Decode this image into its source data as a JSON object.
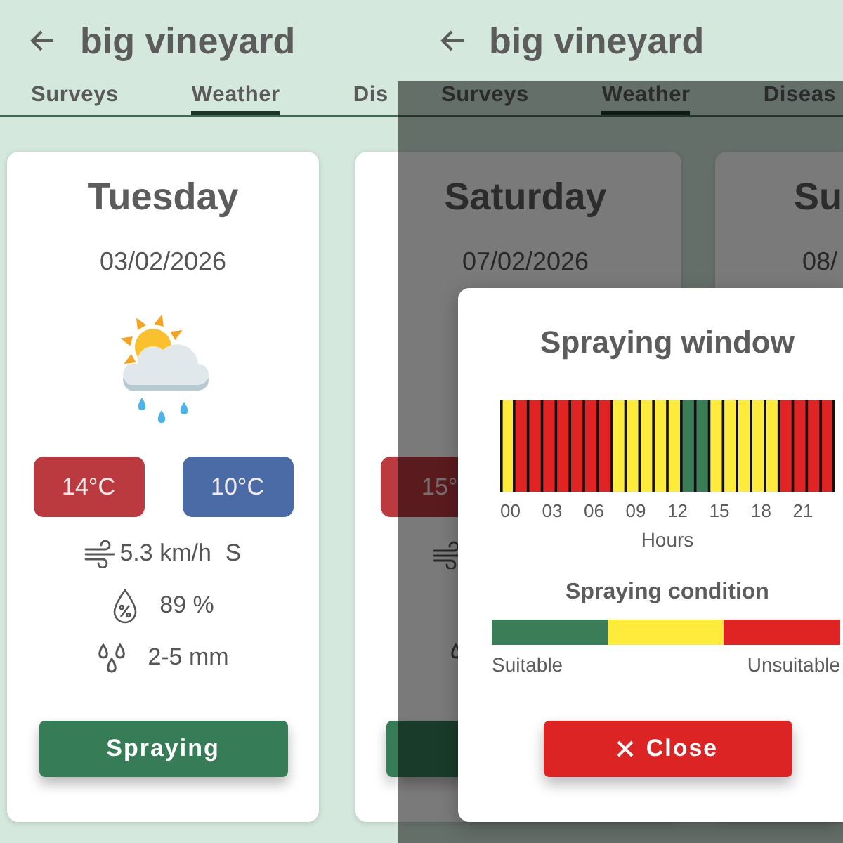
{
  "screens": [
    {
      "header": {
        "title": "big vineyard"
      },
      "tabs": [
        {
          "label": "Surveys",
          "selected": false
        },
        {
          "label": "Weather",
          "selected": true
        },
        {
          "label": "Dis",
          "selected": false
        }
      ],
      "day_cards": [
        {
          "kind": "full",
          "day": "Tuesday",
          "date": "03/02/2026",
          "max_temp": "14°C",
          "min_temp": "10°C",
          "wind_speed": "5.3 km/h",
          "wind_direction": "S",
          "humidity": "89 %",
          "precipitation": "2-5 mm",
          "button": "Spraying"
        },
        {
          "kind": "edge"
        }
      ]
    },
    {
      "header": {
        "title": "big vineyard"
      },
      "tabs": [
        {
          "label": "Surveys",
          "selected": false
        },
        {
          "label": "Weather",
          "selected": true
        },
        {
          "label": "Diseas",
          "selected": false
        }
      ],
      "day_cards": [
        {
          "kind": "behind_dialog",
          "day": "Saturday",
          "date": "07/02/2026",
          "max_temp": "15°"
        },
        {
          "kind": "cut_off",
          "day": "Su",
          "date": "08/"
        }
      ],
      "dialog": {
        "title": "Spraying window",
        "hours": [
          {
            "color": "#ffeb3b"
          },
          {
            "color": "#e02424"
          },
          {
            "color": "#e02424"
          },
          {
            "color": "#e02424"
          },
          {
            "color": "#e02424"
          },
          {
            "color": "#e02424"
          },
          {
            "color": "#e02424"
          },
          {
            "color": "#e02424"
          },
          {
            "color": "#ffeb3b"
          },
          {
            "color": "#ffeb3b"
          },
          {
            "color": "#ffeb3b"
          },
          {
            "color": "#ffeb3b"
          },
          {
            "color": "#ffeb3b"
          },
          {
            "color": "#3a7d56"
          },
          {
            "color": "#3a7d56"
          },
          {
            "color": "#ffeb3b"
          },
          {
            "color": "#ffeb3b"
          },
          {
            "color": "#ffeb3b"
          },
          {
            "color": "#ffeb3b"
          },
          {
            "color": "#ffeb3b"
          },
          {
            "color": "#e02424"
          },
          {
            "color": "#e02424"
          },
          {
            "color": "#e02424"
          },
          {
            "color": "#e02424"
          }
        ],
        "hour_labels": [
          "00",
          "03",
          "06",
          "09",
          "12",
          "15",
          "18",
          "21"
        ],
        "axis_label": "Hours",
        "legend_title": "Spraying condition",
        "legend_segments": [
          {
            "color": "#3a7d56"
          },
          {
            "color": "#ffeb3b"
          },
          {
            "color": "#e02424"
          }
        ],
        "legend_low": "Suitable",
        "legend_high": "Unsuitable",
        "close_button": "Close"
      }
    }
  ]
}
